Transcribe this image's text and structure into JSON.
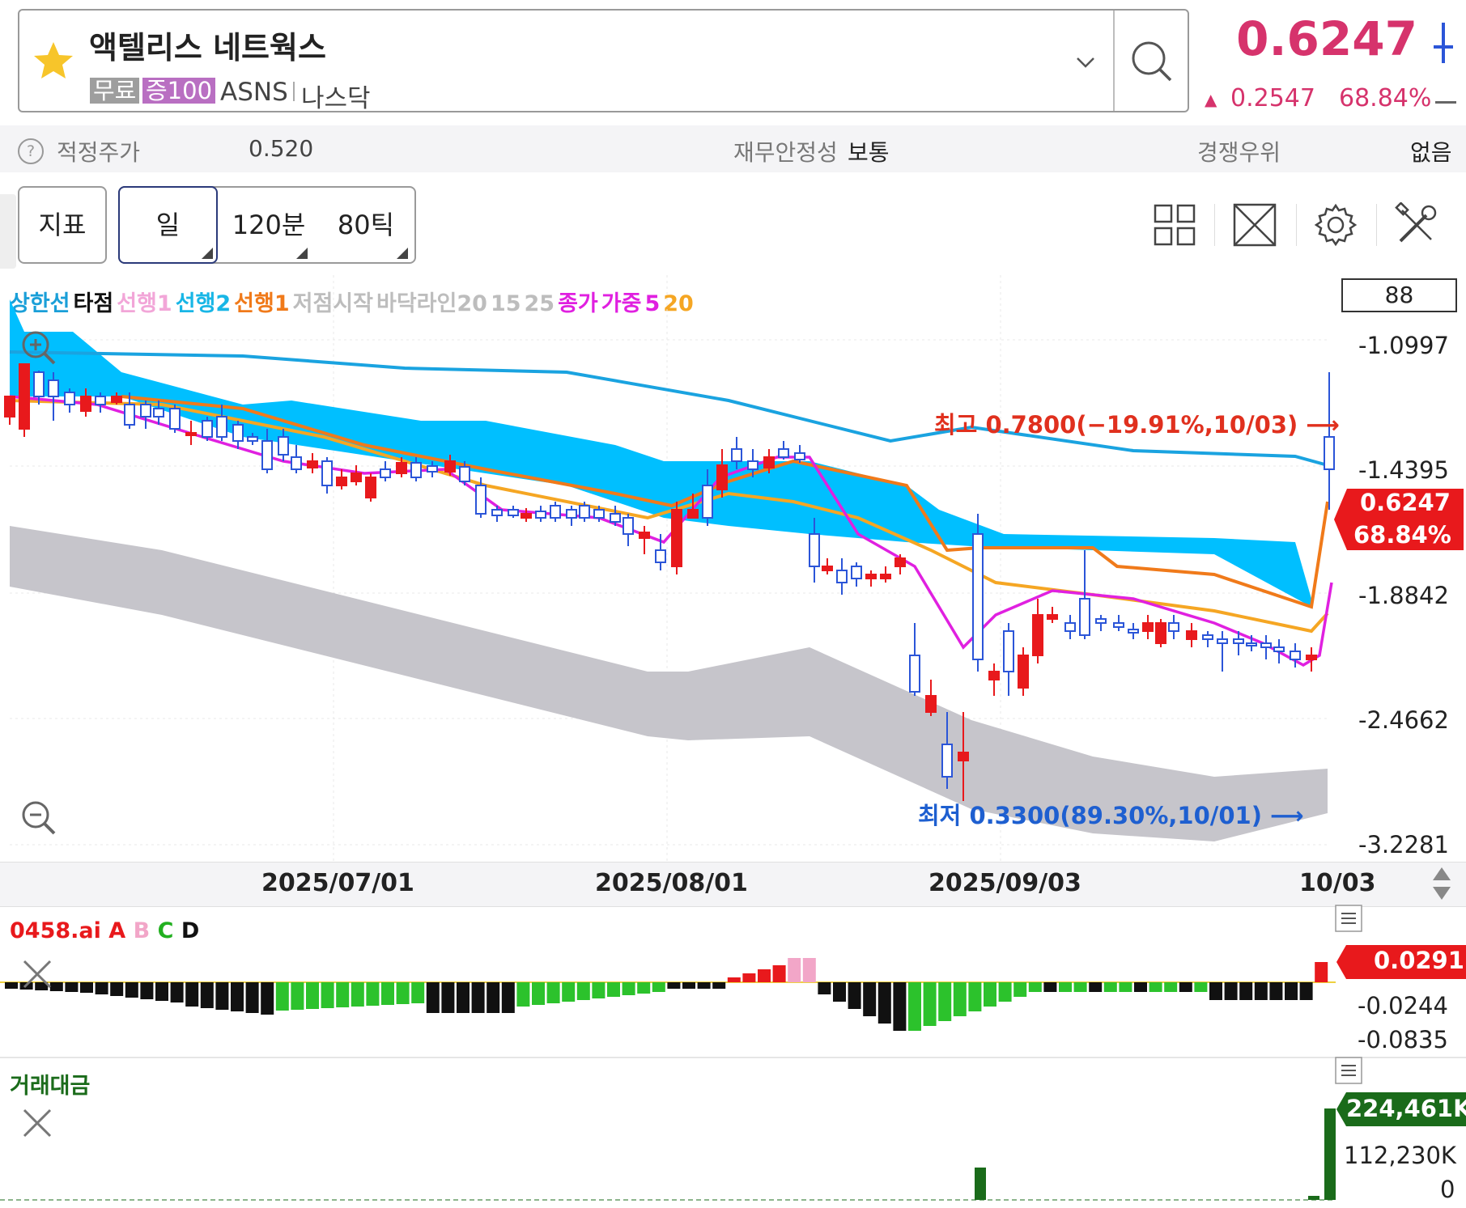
{
  "header": {
    "stock_name": "액텔리스 네트웍스",
    "tag_free": "무료",
    "tag_margin": "증100",
    "ticker": "ASNS",
    "market": "나스닥",
    "price": "0.6247",
    "change_arrow": "▲",
    "change": "0.2547",
    "change_pct": "68.84%"
  },
  "info_row": {
    "fair_price_label": "적정주가",
    "fair_price_value": "0.520",
    "financial_stability_label": "재무안정성",
    "financial_stability_value": "보통",
    "competitive_edge_label": "경쟁우위",
    "competitive_edge_value": "없음"
  },
  "toolbar": {
    "indicator_label": "지표",
    "period_day": "일",
    "period_120min": "120분",
    "period_80tick": "80틱"
  },
  "legend": {
    "items": [
      {
        "text": "상한선",
        "color": "#1a9fd8"
      },
      {
        "text": "타점",
        "color": "#111111"
      },
      {
        "text": "선행1",
        "color": "#f2a6d8"
      },
      {
        "text": "선행2",
        "color": "#18b6e6"
      },
      {
        "text": "선행1",
        "color": "#f07a1a"
      },
      {
        "text": "저점시작",
        "color": "#bdbdbd"
      },
      {
        "text": "바닥라인20",
        "color": "#bdbdbd"
      },
      {
        "text": "15",
        "color": "#bdbdbd"
      },
      {
        "text": "25",
        "color": "#bdbdbd"
      },
      {
        "text": "종가",
        "color": "#e020e0"
      },
      {
        "text": "가중",
        "color": "#e020e0"
      },
      {
        "text": "5",
        "color": "#e020e0"
      },
      {
        "text": "20",
        "color": "#f5a623"
      }
    ],
    "count": "88"
  },
  "chart_data": {
    "type": "candlestick",
    "y_axis_labels": [
      "-1.0997",
      "-1.4395",
      "-1.8842",
      "-2.4662",
      "-3.2281"
    ],
    "x_axis_labels": [
      "2025/07/01",
      "2025/08/01",
      "2025/09/03",
      "10/03"
    ],
    "current_price_label": "0.6247",
    "current_pct_label": "68.84%",
    "high_annotation": "최고 0.7800(−19.91%,10/03) ⟶",
    "low_annotation": "최저 0.3300(89.30%,10/01) ⟶",
    "high": 0.78,
    "low": 0.33,
    "last": 0.6247,
    "colors": {
      "up": "#e8191c",
      "down": "#2b55d8",
      "cloud": "#00bfff",
      "band": "#c6c5cb",
      "upper": "#1aa3e0",
      "ma5": "#e020e0",
      "ma20": "#f5a623",
      "lead": "#f07a1a"
    }
  },
  "ai_panel": {
    "legend_prefix": "0458.ai",
    "legend_a": "A",
    "legend_b": "B",
    "legend_c": "C",
    "legend_d": "D",
    "value_tag": "0.0291",
    "y_labels": [
      "-0.0244",
      "-0.0835"
    ]
  },
  "volume_panel": {
    "legend": "거래대금",
    "value_tag": "224,461K",
    "y_labels": [
      "112,230K",
      "0"
    ]
  }
}
